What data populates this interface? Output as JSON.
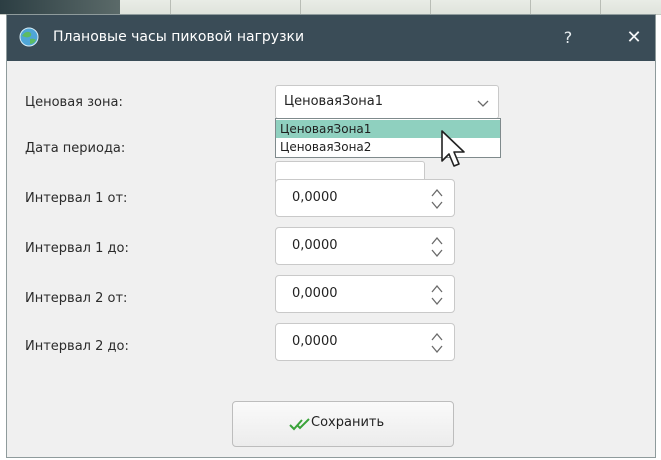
{
  "window": {
    "title": "Плановые часы пиковой нагрузки",
    "help_label": "?",
    "close_label": "✕"
  },
  "form": {
    "price_zone": {
      "label": "Ценовая зона:",
      "selected_value": "ЦеноваяЗона1",
      "options": [
        "ЦеноваяЗона1",
        "ЦеноваяЗона2"
      ],
      "highlighted_index": 0
    },
    "period_date": {
      "label": "Дата периода:",
      "value": ""
    },
    "interval1_from": {
      "label": "Интервал 1 от:",
      "value": "0,0000"
    },
    "interval1_to": {
      "label": "Интервал 1 до:",
      "value": "0,0000"
    },
    "interval2_from": {
      "label": "Интервал 2 от:",
      "value": "0,0000"
    },
    "interval2_to": {
      "label": "Интервал 2 до:",
      "value": "0,0000"
    }
  },
  "actions": {
    "save_label": "Сохранить",
    "save_icon": "double-check-icon"
  },
  "colors": {
    "titlebar": "#3a4c57",
    "dialog_bg": "#f0f0f0",
    "dropdown_highlight": "#8fd0bf",
    "save_icon_green": "#3aa33a"
  }
}
